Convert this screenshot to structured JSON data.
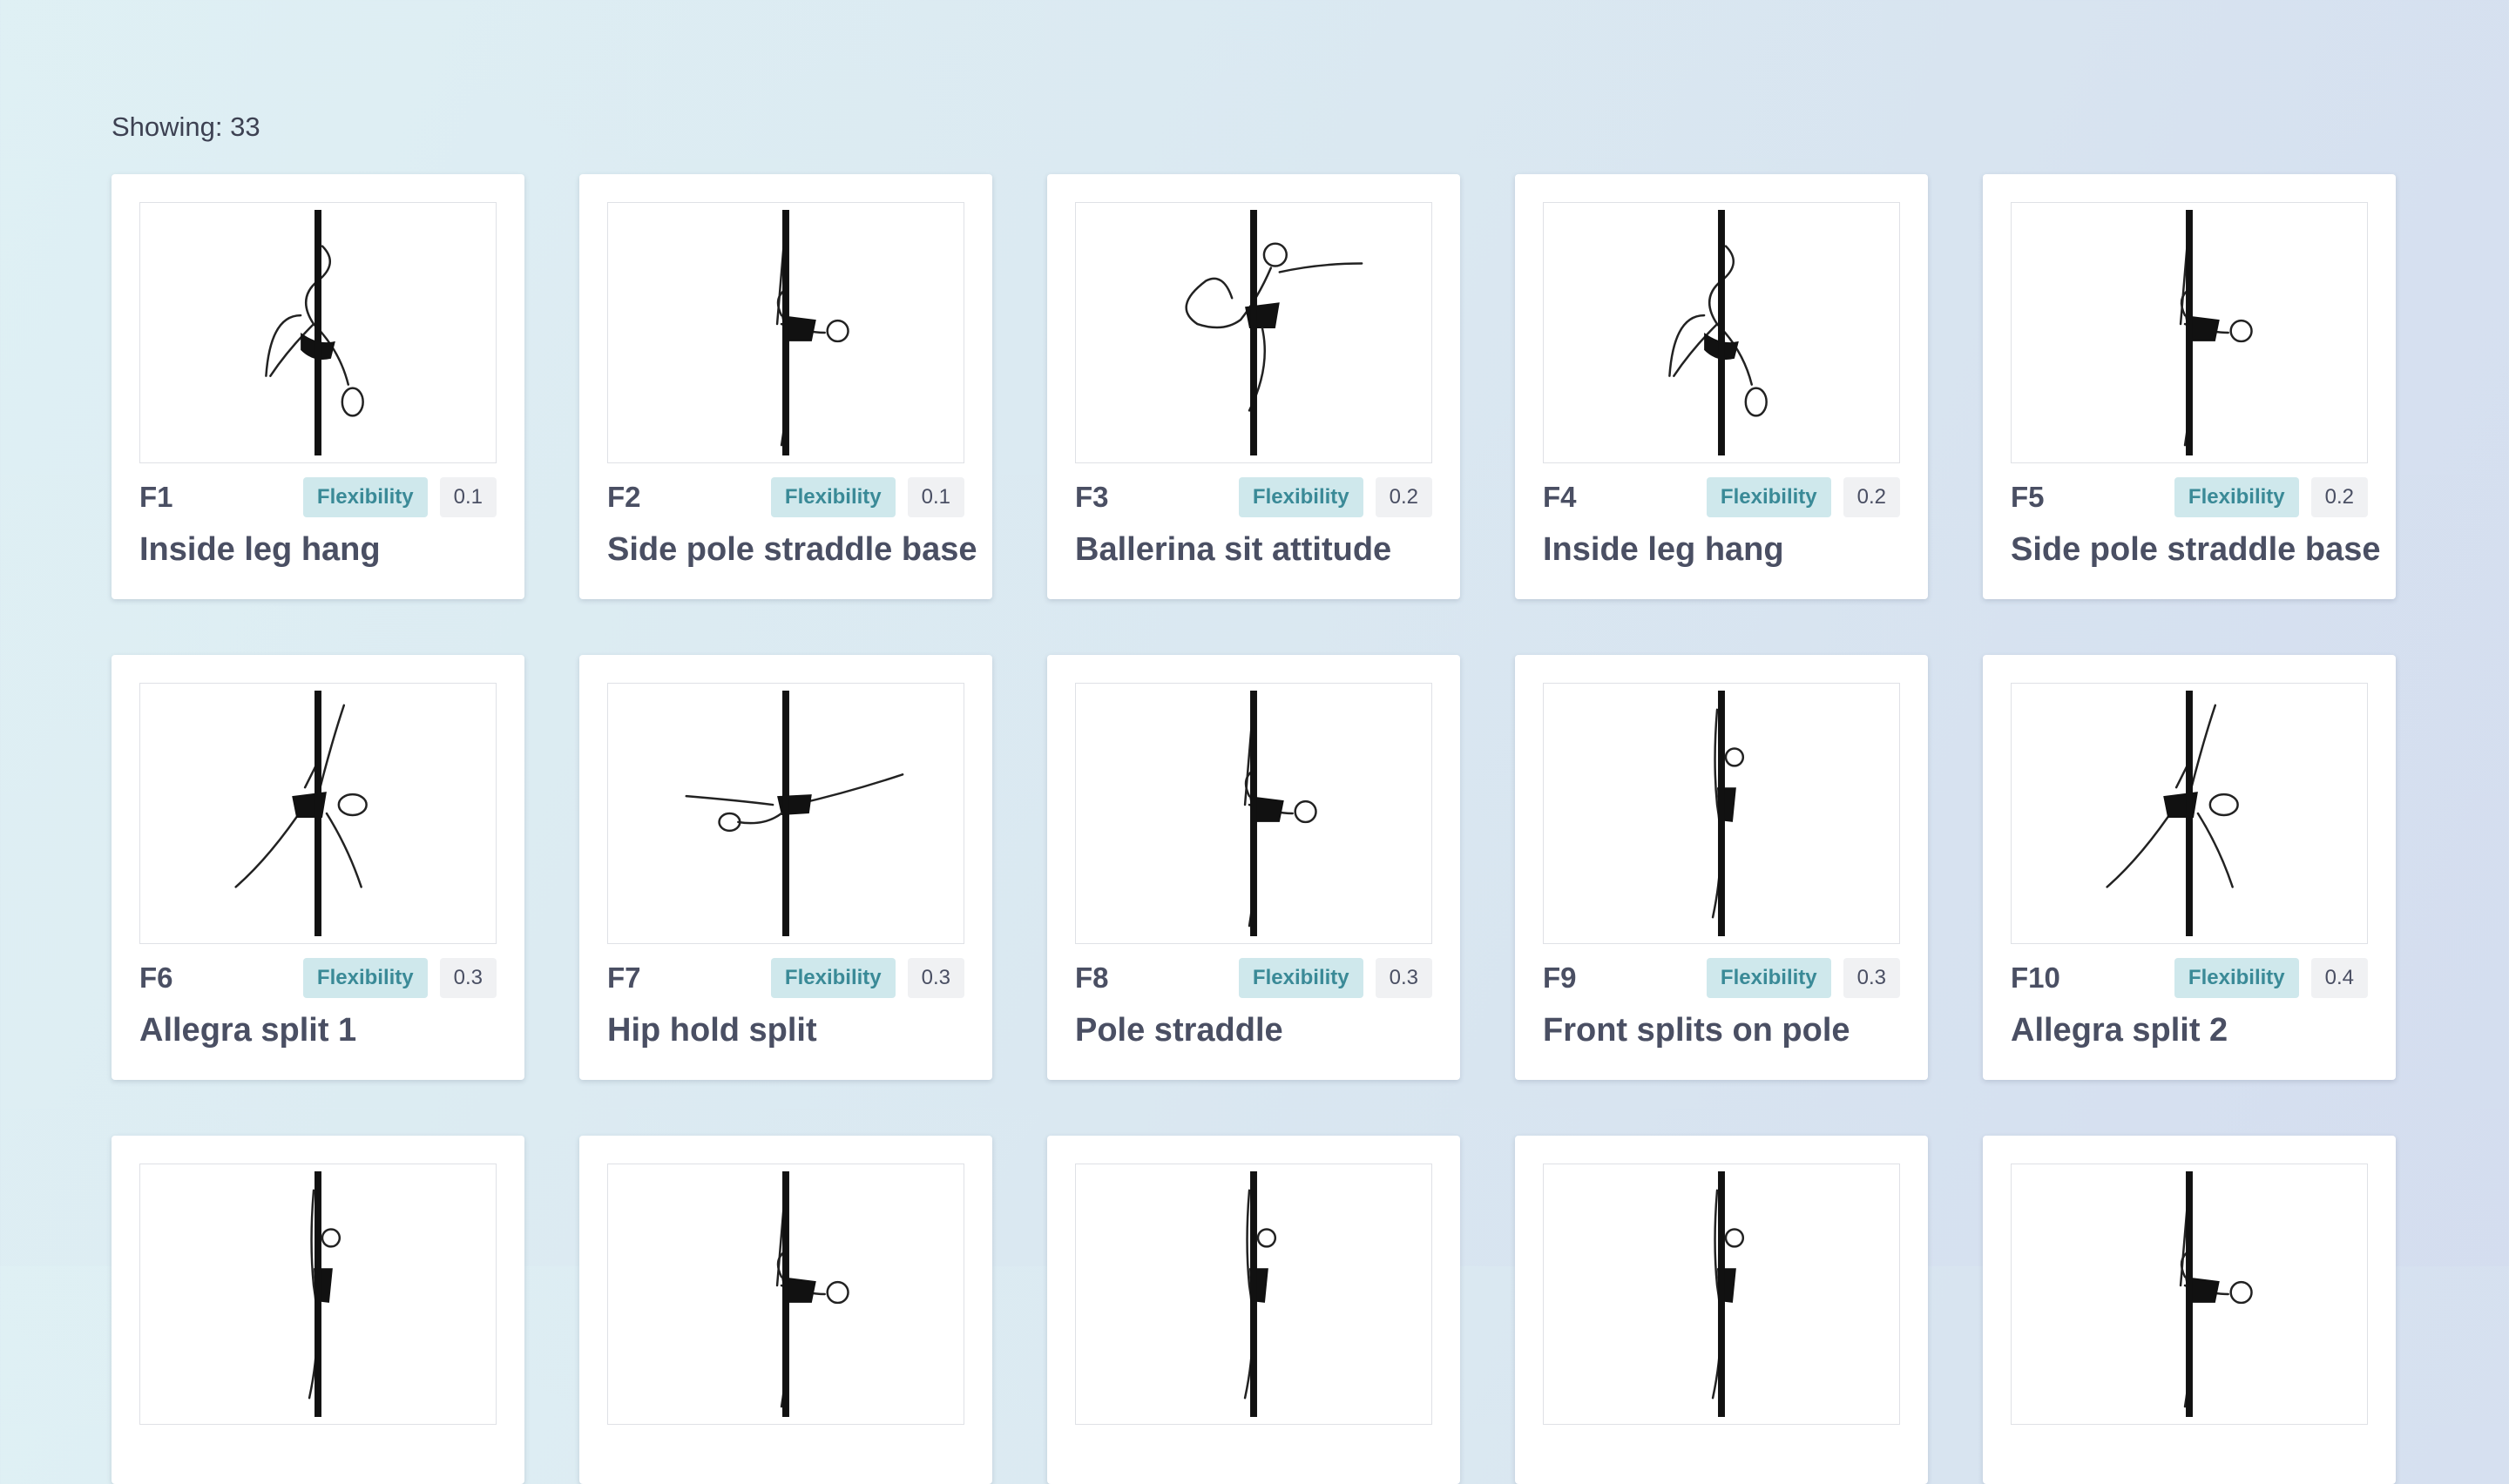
{
  "showing_label": "Showing: 33",
  "cards": [
    {
      "code": "F1",
      "tag": "Flexibility",
      "score": "0.1",
      "title": "Inside leg hang",
      "pose": "inside-leg-hang"
    },
    {
      "code": "F2",
      "tag": "Flexibility",
      "score": "0.1",
      "title": "Side pole straddle base",
      "pose": "side-straddle"
    },
    {
      "code": "F3",
      "tag": "Flexibility",
      "score": "0.2",
      "title": "Ballerina sit attitude",
      "pose": "ballerina"
    },
    {
      "code": "F4",
      "tag": "Flexibility",
      "score": "0.2",
      "title": "Inside leg hang",
      "pose": "inside-leg-hang"
    },
    {
      "code": "F5",
      "tag": "Flexibility",
      "score": "0.2",
      "title": "Side pole straddle base",
      "pose": "side-straddle"
    },
    {
      "code": "F6",
      "tag": "Flexibility",
      "score": "0.3",
      "title": "Allegra split 1",
      "pose": "allegra"
    },
    {
      "code": "F7",
      "tag": "Flexibility",
      "score": "0.3",
      "title": "Hip hold split",
      "pose": "hip-hold"
    },
    {
      "code": "F8",
      "tag": "Flexibility",
      "score": "0.3",
      "title": "Pole straddle",
      "pose": "side-straddle"
    },
    {
      "code": "F9",
      "tag": "Flexibility",
      "score": "0.3",
      "title": "Front splits on pole",
      "pose": "front-splits"
    },
    {
      "code": "F10",
      "tag": "Flexibility",
      "score": "0.4",
      "title": "Allegra split 2",
      "pose": "allegra"
    }
  ],
  "partial_cards_count": 5,
  "colors": {
    "tag_bg": "#cfe8ec",
    "tag_text": "#3a8a97",
    "score_bg": "#f0f1f3"
  }
}
